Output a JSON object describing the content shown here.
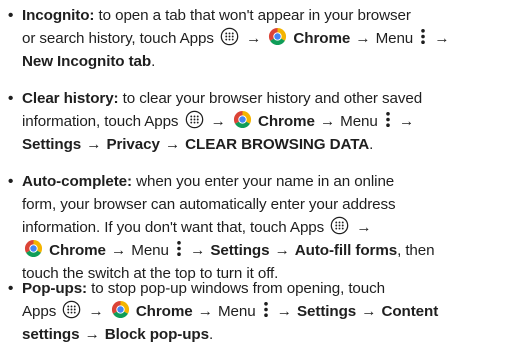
{
  "items": [
    {
      "term": "Incognito:",
      "line1": "to open a tab that won't appear in your browser",
      "line2a": "or search history, touch Apps",
      "chrome": "Chrome",
      "menu": "Menu",
      "new_tab": "New Incognito tab",
      "period": "."
    },
    {
      "term": "Clear history:",
      "line1": "to clear your browser history and other saved",
      "line2a": "information, touch Apps",
      "chrome": "Chrome",
      "menu": "Menu",
      "settings": "Settings",
      "privacy": "Privacy",
      "clear": "CLEAR BROWSING DATA",
      "period": "."
    },
    {
      "term": "Auto-complete:",
      "line1": "when you enter your name in an online",
      "line2": "form, your browser can automatically enter your address",
      "line3": "information. If you don't want that, touch Apps",
      "chrome": "Chrome",
      "menu": "Menu",
      "settings": "Settings",
      "autofill": "Auto-fill forms",
      "then": ", then",
      "line5": "touch the switch at the top to turn it off."
    },
    {
      "term": "Pop-ups:",
      "line1": "to stop pop-up windows from opening, touch",
      "apps": "Apps",
      "chrome": "Chrome",
      "menu": "Menu",
      "settings": "Settings",
      "content": "Content",
      "content2": "settings",
      "block": "Block pop-ups",
      "period": "."
    }
  ],
  "glyphs": {
    "bullet": "•",
    "arrow": "→"
  },
  "icons": {
    "apps": "apps-icon",
    "chrome": "chrome-icon",
    "menu": "menu-dots-icon"
  },
  "colors": {
    "text": "#1f1f1f",
    "chrome_red": "#db4437",
    "chrome_yellow": "#f4b400",
    "chrome_green": "#0f9d58",
    "chrome_blue": "#4285f4"
  }
}
